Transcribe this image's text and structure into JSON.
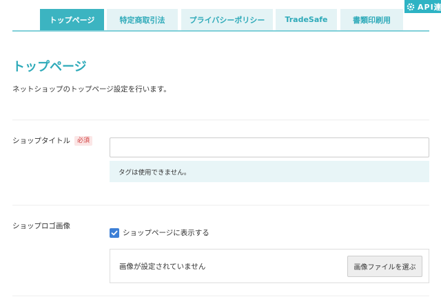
{
  "api_badge": {
    "label": "API連",
    "icon": "gear-icon"
  },
  "tabs": [
    {
      "label": "トップページ",
      "active": true
    },
    {
      "label": "特定商取引法",
      "active": false
    },
    {
      "label": "プライバシーポリシー",
      "active": false
    },
    {
      "label": "TradeSafe",
      "active": false
    },
    {
      "label": "書類印刷用",
      "active": false
    }
  ],
  "page": {
    "title": "トップページ",
    "description": "ネットショップのトップページ設定を行います。"
  },
  "shop_title": {
    "label": "ショップタイトル",
    "required_badge": "必須",
    "value": "",
    "hint": "タグは使用できません。"
  },
  "shop_logo": {
    "label": "ショップロゴ画像",
    "checkbox_label": "ショップページに表示する",
    "checked": true,
    "status": "画像が設定されていません",
    "button_label": "画像ファイルを選ぶ"
  },
  "colors": {
    "accent": "#3cb4c1",
    "tab_bg": "#e4f3f5",
    "required": "#d03a3a",
    "checkbox": "#3d7fd6"
  }
}
